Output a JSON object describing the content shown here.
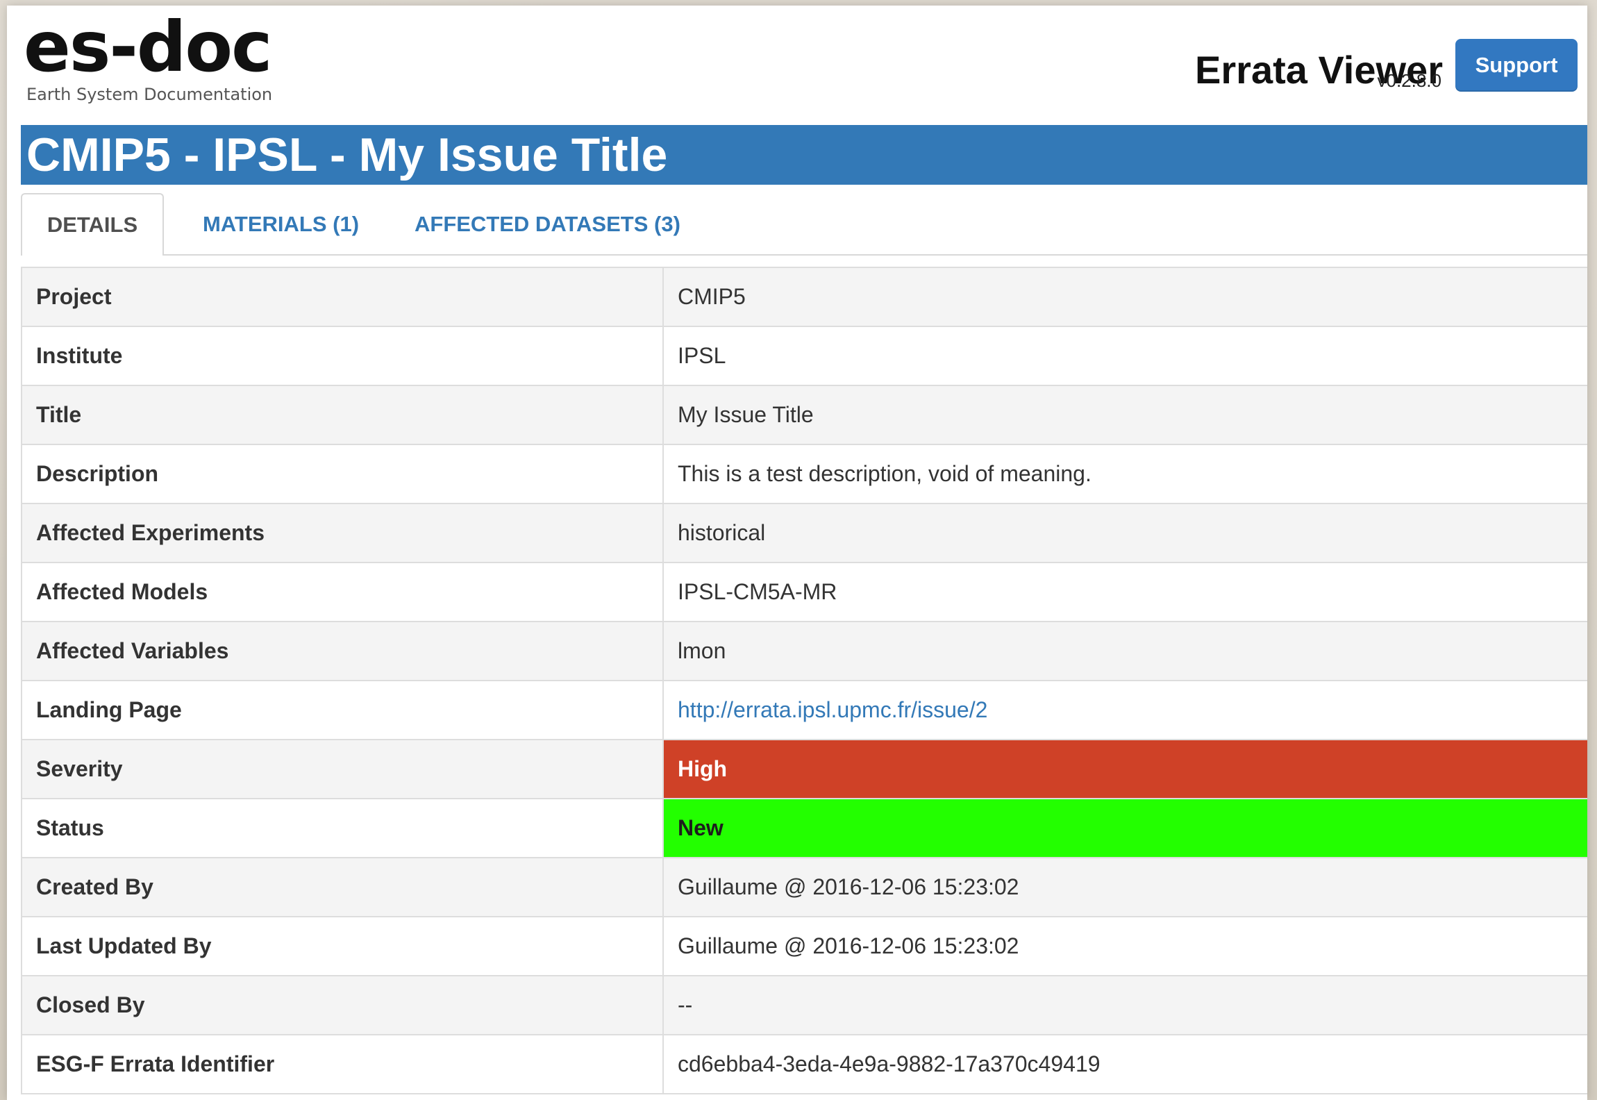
{
  "header": {
    "brand_title": "es-doc",
    "brand_subtitle": "Earth System Documentation",
    "viewer_name": "Errata Viewer",
    "viewer_version": "v0.2.8.0",
    "support_label": "Support"
  },
  "issue": {
    "title": "CMIP5 - IPSL - My Issue Title"
  },
  "tabs": [
    {
      "label": "DETAILS",
      "active": true
    },
    {
      "label": "MATERIALS (1)",
      "active": false
    },
    {
      "label": "AFFECTED DATASETS (3)",
      "active": false
    }
  ],
  "details": [
    {
      "label": "Project",
      "value": "CMIP5"
    },
    {
      "label": "Institute",
      "value": "IPSL"
    },
    {
      "label": "Title",
      "value": "My Issue Title"
    },
    {
      "label": "Description",
      "value": "This is a test description, void of meaning."
    },
    {
      "label": "Affected Experiments",
      "value": "historical"
    },
    {
      "label": "Affected Models",
      "value": "IPSL-CM5A-MR"
    },
    {
      "label": "Affected Variables",
      "value": "lmon"
    },
    {
      "label": "Landing Page",
      "value": "http://errata.ipsl.upmc.fr/issue/2"
    },
    {
      "label": "Severity",
      "value": "High"
    },
    {
      "label": "Status",
      "value": "New"
    },
    {
      "label": "Created By",
      "value": "Guillaume @ 2016-12-06 15:23:02"
    },
    {
      "label": "Last Updated By",
      "value": "Guillaume @ 2016-12-06 15:23:02"
    },
    {
      "label": "Closed By",
      "value": "--"
    },
    {
      "label": "ESG-F Errata Identifier",
      "value": "cd6ebba4-3eda-4e9a-9882-17a370c49419"
    }
  ],
  "colors": {
    "primary_blue": "#3379b7",
    "severity_high": "#cf4127",
    "status_new": "#23ff00"
  }
}
